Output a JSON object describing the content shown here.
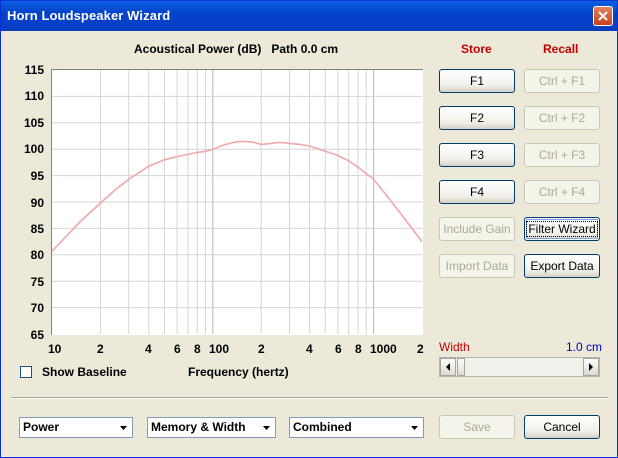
{
  "window": {
    "title": "Horn Loudspeaker Wizard"
  },
  "plot": {
    "title": "Acoustical Power (dB)   Path 0.0 cm"
  },
  "chart_data": {
    "type": "line",
    "title": "Acoustical Power (dB)   Path 0.0 cm",
    "xlabel": "Frequency (hertz)",
    "ylabel": "",
    "xscale": "log",
    "xlim": [
      10,
      2000
    ],
    "ylim": [
      65,
      115
    ],
    "yticks": [
      "115",
      "110",
      "105",
      "100",
      "95",
      "90",
      "85",
      "80",
      "75",
      "70",
      "65"
    ],
    "xticks": [
      "10",
      "2",
      "4",
      "6",
      "8",
      "100",
      "2",
      "4",
      "6",
      "8",
      "1000",
      "2"
    ],
    "grid": true,
    "color": "#F0A8A8",
    "series": [
      {
        "x": [
          10,
          12,
          15,
          20,
          25,
          30,
          40,
          50,
          60,
          70,
          80,
          90,
          100,
          120,
          140,
          160,
          180,
          200,
          230,
          260,
          300,
          350,
          400,
          500,
          600,
          700,
          800,
          1000,
          1200,
          1500,
          2000
        ],
        "y": [
          80.7,
          83.2,
          86.3,
          89.8,
          92.4,
          94.3,
          96.8,
          98.0,
          98.6,
          99.0,
          99.4,
          99.6,
          100.0,
          100.9,
          101.4,
          101.5,
          101.3,
          100.9,
          101.1,
          101.3,
          101.1,
          100.9,
          100.6,
          99.6,
          98.8,
          97.8,
          96.6,
          94.3,
          91.3,
          87.5,
          82.5
        ]
      }
    ]
  },
  "checkbox": {
    "label": "Show Baseline",
    "checked": false
  },
  "headers": {
    "store": "Store",
    "recall": "Recall"
  },
  "buttons": {
    "f1": "F1",
    "f2": "F2",
    "f3": "F3",
    "f4": "F4",
    "ctrl_f1": "Ctrl + F1",
    "ctrl_f2": "Ctrl + F2",
    "ctrl_f3": "Ctrl + F3",
    "ctrl_f4": "Ctrl + F4",
    "include_gain": "Include Gain",
    "filter_wizard": "Filter Wizard",
    "import_data": "Import Data",
    "export_data": "Export Data",
    "save": "Save",
    "cancel": "Cancel"
  },
  "width": {
    "label": "Width",
    "value": "1.0 cm"
  },
  "selects": {
    "mode": "Power",
    "view": "Memory & Width",
    "display": "Combined"
  }
}
